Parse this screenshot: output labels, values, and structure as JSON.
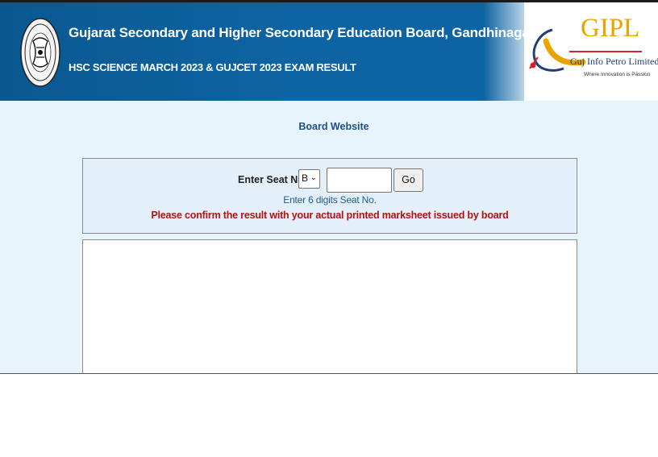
{
  "header": {
    "board_name": "Gujarat Secondary and Higher Secondary Education Board, Gandhinagar",
    "exam_title": "HSC SCIENCE MARCH 2023 & GUJCET 2023 EXAM RESULT",
    "logo": {
      "name": "GIPL",
      "company": "Guj Info Petro Limited",
      "tagline": "Where Innovation is Passion"
    }
  },
  "board_link": {
    "label": "Board Website"
  },
  "seat_form": {
    "label": "Enter Seat No :",
    "series_selected": "B",
    "seat_value": "",
    "go_label": "Go",
    "hint": "Enter 6 digits Seat No.",
    "warning": "Please confirm the result with your actual printed marksheet issued by board"
  },
  "colors": {
    "header_blue": "#0e64a3",
    "background": "#e8f4fc",
    "warning_red": "#b31212",
    "link_blue": "#1c4f8a",
    "logo_gold": "#e9a400"
  },
  "icons": {
    "seal": "board-seal-icon",
    "logo_swoosh": "gipl-swoosh-icon",
    "dropdown": "chevron-down-icon"
  }
}
